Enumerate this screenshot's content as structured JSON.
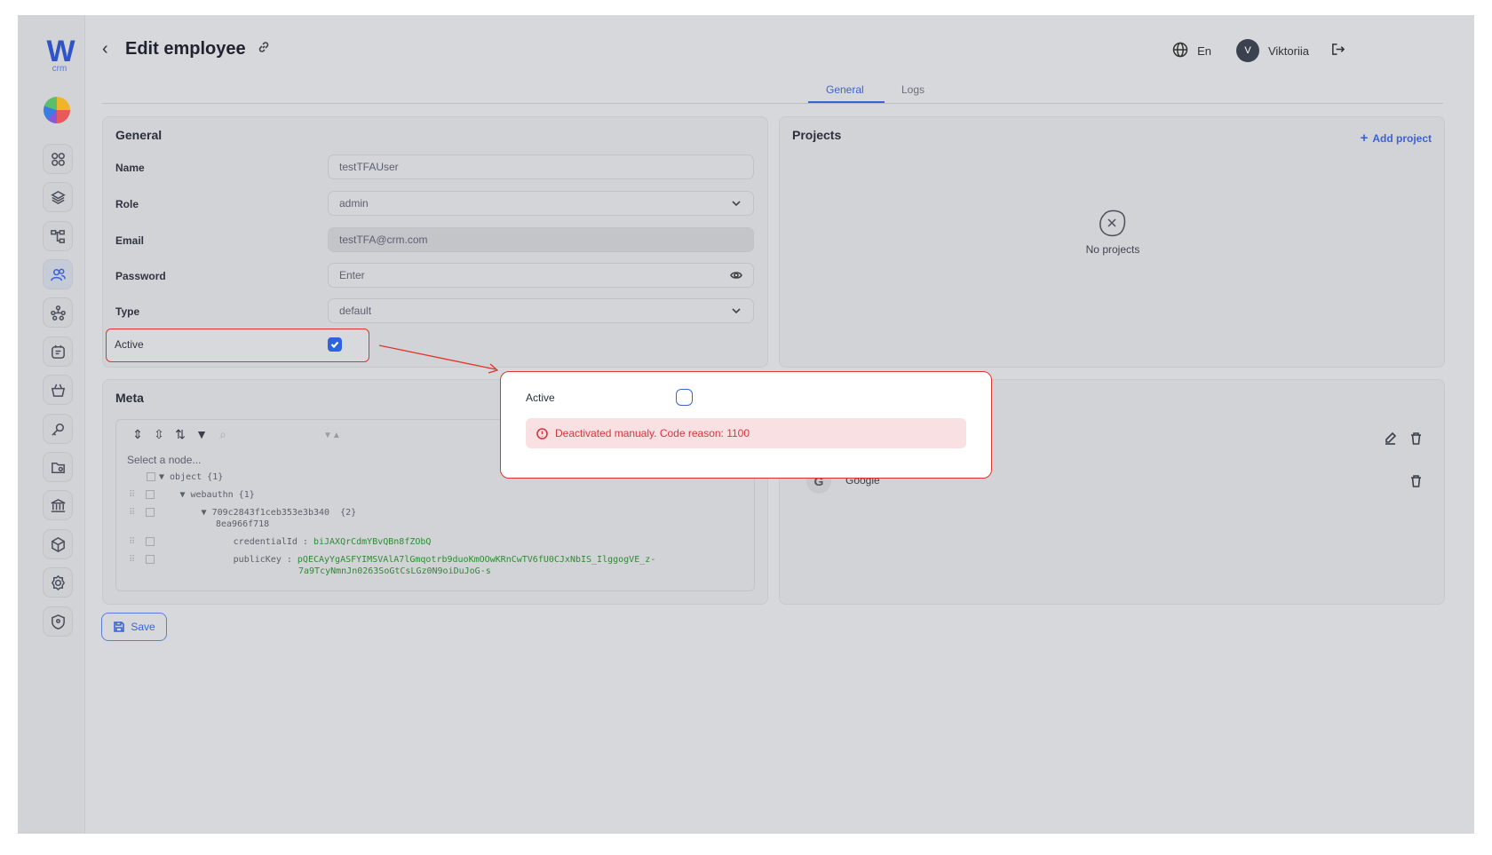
{
  "brand": {
    "logo_letter": "W",
    "logo_sub": "crm"
  },
  "sidebar": {
    "items": [
      {
        "icon": "dashboard-icon"
      },
      {
        "icon": "layers-icon"
      },
      {
        "icon": "hierarchy-icon"
      },
      {
        "icon": "users-icon",
        "active": true
      },
      {
        "icon": "network-icon"
      },
      {
        "icon": "tasks-icon"
      },
      {
        "icon": "basket-icon"
      },
      {
        "icon": "key-icon"
      },
      {
        "icon": "folder-icon"
      },
      {
        "icon": "bank-icon"
      },
      {
        "icon": "cube-icon"
      },
      {
        "icon": "settings-icon"
      },
      {
        "icon": "shield-icon"
      }
    ]
  },
  "header": {
    "back": "‹",
    "title": "Edit employee",
    "language": "En",
    "avatar_initial": "V",
    "user_name": "Viktoriia"
  },
  "tabs": [
    {
      "label": "General",
      "active": true
    },
    {
      "label": "Logs",
      "active": false
    }
  ],
  "general": {
    "title": "General",
    "name": {
      "label": "Name",
      "value": "testTFAUser"
    },
    "role": {
      "label": "Role",
      "value": "admin"
    },
    "email": {
      "label": "Email",
      "value": "testTFA@crm.com"
    },
    "password": {
      "label": "Password",
      "placeholder": "Enter"
    },
    "type": {
      "label": "Type",
      "value": "default"
    },
    "active": {
      "label": "Active",
      "checked": true
    }
  },
  "projects": {
    "title": "Projects",
    "add_label": "Add project",
    "empty_text": "No projects"
  },
  "meta": {
    "title": "Meta",
    "select_node": "Select a node...",
    "rows": {
      "object": "▼ object {1}",
      "webauthn": "▼ webauthn {1}",
      "id_line1": "▼ 709c2843f1ceb353e3b340  {2}",
      "id_line2": "8ea966f718",
      "credential_key": "credentialId : ",
      "credential_val": "biJAXQrCdmYBvQBn8fZObQ",
      "publickey_key": "publicKey : ",
      "publickey_val1": "pQECAyYgASFYIMSVAlA7lGmqotrb9duoKmOOwKRnCwTV6fU0CJxNbIS_IlggogVE_z-",
      "publickey_val2": "7a9TcyNmnJn0263SoGtCsLGz0N9oiDuJoG-s"
    }
  },
  "providers": {
    "items": [
      {
        "name": "Google",
        "logo": "G"
      }
    ]
  },
  "save": {
    "label": "Save"
  },
  "popup": {
    "label": "Active",
    "checked": false,
    "error": "Deactivated manualy. Code reason: 1100"
  },
  "colors": {
    "accent": "#3b63d6",
    "highlight": "#e0352b",
    "error_bg": "#f9e1e3"
  }
}
